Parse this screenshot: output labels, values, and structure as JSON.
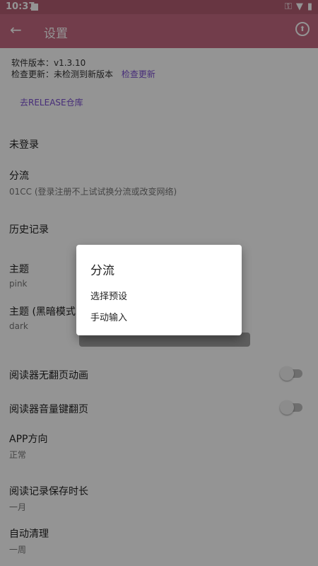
{
  "status": {
    "time": "10:37"
  },
  "appbar": {
    "title": "设置"
  },
  "info": {
    "version_line": "软件版本：v1.3.10",
    "check_label": "检查更新：未检测到新版本",
    "check_link": "检查更新",
    "release_link": "去RELEASE仓库"
  },
  "settings": {
    "login": "未登录",
    "split": {
      "label": "分流",
      "value": "01CC (登录注册不上试试换分流或改变网络)"
    },
    "history": "历史记录",
    "theme": {
      "label": "主题",
      "value": "pink"
    },
    "theme_dark": {
      "label": "主题 (黑暗模式)",
      "value": "dark"
    },
    "reader_anim": {
      "label": "阅读器无翻页动画",
      "enabled": false
    },
    "reader_volume": {
      "label": "阅读器音量键翻页",
      "enabled": false
    },
    "orientation": {
      "label": "APP方向",
      "value": "正常"
    },
    "record_duration": {
      "label": "阅读记录保存时长",
      "value": "一月"
    },
    "auto_clean": {
      "label": "自动清理",
      "value": "一周"
    }
  },
  "dialog": {
    "title": "分流",
    "options": [
      "选择预设",
      "手动输入"
    ]
  }
}
